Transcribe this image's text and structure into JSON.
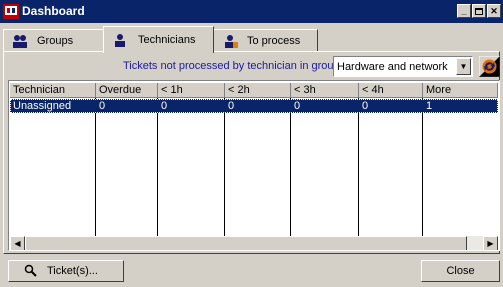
{
  "window": {
    "title": "Dashboard"
  },
  "tabs": [
    {
      "label": "Groups",
      "icon": "groups-icon",
      "active": false
    },
    {
      "label": "Technicians",
      "icon": "technician-icon",
      "active": true
    },
    {
      "label": "To process",
      "icon": "to-process-icon",
      "active": false
    }
  ],
  "filter": {
    "label": "Tickets not processed by technician in group:",
    "group_value": "Hardware and network"
  },
  "table": {
    "columns": [
      "Technician",
      "Overdue",
      "< 1h",
      "< 2h",
      "< 3h",
      "< 4h",
      "More"
    ],
    "rows": [
      [
        "Unassigned",
        "0",
        "0",
        "0",
        "0",
        "0",
        "1"
      ]
    ]
  },
  "buttons": {
    "tickets": "Ticket(s)...",
    "close": "Close"
  },
  "colors": {
    "titlebar": "#0a246a",
    "selection": "#0a246a",
    "face": "#d4d0c8",
    "label_blue": "#1a1aa0"
  }
}
